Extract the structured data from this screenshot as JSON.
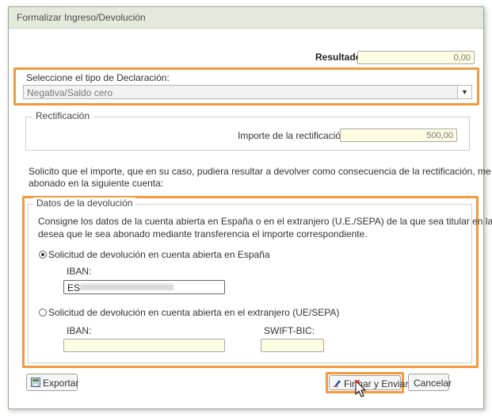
{
  "window": {
    "title": "Formalizar Ingreso/Devolución"
  },
  "resultado": {
    "label": "Resultado",
    "value": "0,00"
  },
  "declaracion": {
    "label": "Seleccione el tipo de Declaración:",
    "selected": "Negativa/Saldo cero",
    "arrow_icon": "chevron-down-icon"
  },
  "rectificacion": {
    "legend": "Rectificación",
    "importe_label": "Importe de la rectificación:",
    "importe_value": "500,00"
  },
  "solicito": {
    "line1": "Solicito que el importe, que en su caso, pudiera resultar a devolver como consecuencia de la rectificación, me sea",
    "line2": "abonado en la siguiente cuenta:"
  },
  "devolucion": {
    "legend": "Datos de la devolución",
    "intro1": "Consigne los datos de la cuenta abierta en España o en el extranjero (U.E./SEPA) de la que sea titular en la que",
    "intro2": "desea que le sea abonado mediante transferencia el importe correspondiente.",
    "option_espana": "Solicitud de devolución en cuenta abierta en España",
    "option_espana_checked": true,
    "iban_label": "IBAN:",
    "iban_value": "ES",
    "option_extranjero": "Solicitud de devolución en cuenta abierta en el extranjero (UE/SEPA)",
    "option_extranjero_checked": false,
    "iban_ext_label": "IBAN:",
    "iban_ext_value": "",
    "swift_label": "SWIFT-BIC:",
    "swift_value": ""
  },
  "footer": {
    "exportar_label": "Exportar",
    "firmar_label": "Firmar y Enviar",
    "cancelar_label": "Cancelar"
  },
  "colors": {
    "highlight": "#f39a3c",
    "field_bg": "#fefde1",
    "titlebar_bg": "#e3eadc"
  }
}
